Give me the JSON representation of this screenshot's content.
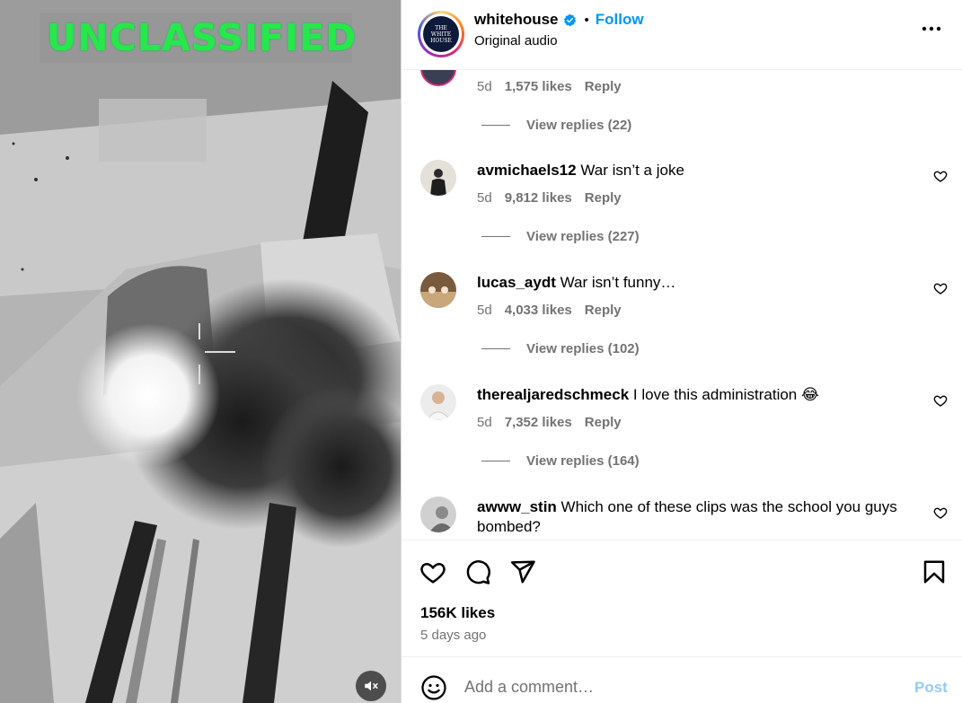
{
  "media": {
    "overlay_text": "UNCLASSIFIED",
    "mute_icon": "muted-speaker-icon"
  },
  "post": {
    "owner": "whitehouse",
    "separator": "•",
    "follow_label": "Follow",
    "audio_label": "Original audio",
    "avatar_text_line1": "THE",
    "avatar_text_line2": "WHITE",
    "avatar_text_line3": "HOUSE",
    "likes_total": "156K likes",
    "posted": "5 days ago"
  },
  "comments": [
    {
      "user": "",
      "text": "",
      "age": "5d",
      "likes": "1,575 likes",
      "reply_label": "Reply",
      "view_replies": "View replies (22)"
    },
    {
      "user": "avmichaels12",
      "text": "War isn’t a joke",
      "age": "5d",
      "likes": "9,812 likes",
      "reply_label": "Reply",
      "view_replies": "View replies (227)"
    },
    {
      "user": "lucas_aydt",
      "text": "War isn’t funny…",
      "age": "5d",
      "likes": "4,033 likes",
      "reply_label": "Reply",
      "view_replies": "View replies (102)"
    },
    {
      "user": "therealjaredschmeck",
      "text": "I love this administration 😂",
      "age": "5d",
      "likes": "7,352 likes",
      "reply_label": "Reply",
      "view_replies": "View replies (164)"
    },
    {
      "user": "awww_stin",
      "text": "Which one of these clips was the school you guys bombed?"
    }
  ],
  "composer": {
    "placeholder": "Add a comment…",
    "post_label": "Post"
  },
  "colors": {
    "accent": "#0095f6",
    "post_disabled": "#93cbfa",
    "meta_text": "#737373",
    "overlay_green": "#27e84a"
  }
}
